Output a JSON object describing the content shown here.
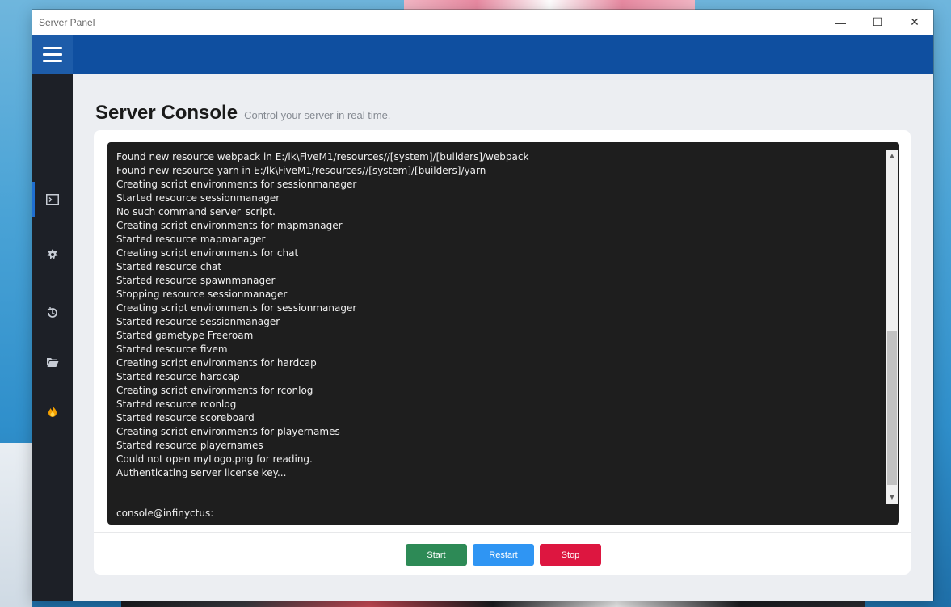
{
  "window": {
    "title": "Server Panel",
    "controls": {
      "minimize": "—",
      "maximize": "☐",
      "close": "✕"
    }
  },
  "sidebar": {
    "items": [
      {
        "icon": "terminal-icon",
        "glyph": "⊡",
        "active": true
      },
      {
        "icon": "plugin-icon",
        "glyph": "✸",
        "active": false
      },
      {
        "icon": "history-icon",
        "glyph": "↺",
        "active": false
      },
      {
        "icon": "folder-icon",
        "glyph": "▰",
        "active": false
      },
      {
        "icon": "fire-icon",
        "glyph": "🔥",
        "active": false
      }
    ]
  },
  "page": {
    "title": "Server Console",
    "subtitle": "Control your server in real time."
  },
  "console": {
    "lines": [
      "Found new resource webpack in E:/lk\\FiveM1/resources//[system]/[builders]/webpack",
      "Found new resource yarn in E:/lk\\FiveM1/resources//[system]/[builders]/yarn",
      "Creating script environments for sessionmanager",
      "Started resource sessionmanager",
      "No such command server_script.",
      "Creating script environments for mapmanager",
      "Started resource mapmanager",
      "Creating script environments for chat",
      "Started resource chat",
      "Started resource spawnmanager",
      "Stopping resource sessionmanager",
      "Creating script environments for sessionmanager",
      "Started resource sessionmanager",
      "Started gametype Freeroam",
      "Started resource fivem",
      "Creating script environments for hardcap",
      "Started resource hardcap",
      "Creating script environments for rconlog",
      "Started resource rconlog",
      "Started resource scoreboard",
      "Creating script environments for playernames",
      "Started resource playernames",
      "Could not open myLogo.png for reading.",
      "Authenticating server license key..."
    ],
    "prompt": "console@infinyctus:"
  },
  "buttons": {
    "start": {
      "label": "Start",
      "color": "#2d8a56"
    },
    "restart": {
      "label": "Restart",
      "color": "#2f95f3"
    },
    "stop": {
      "label": "Stop",
      "color": "#dd1640"
    }
  },
  "colors": {
    "appbar": "#0f4fa0",
    "sidebar": "#1d2027",
    "console_bg": "#1e1e1e"
  }
}
